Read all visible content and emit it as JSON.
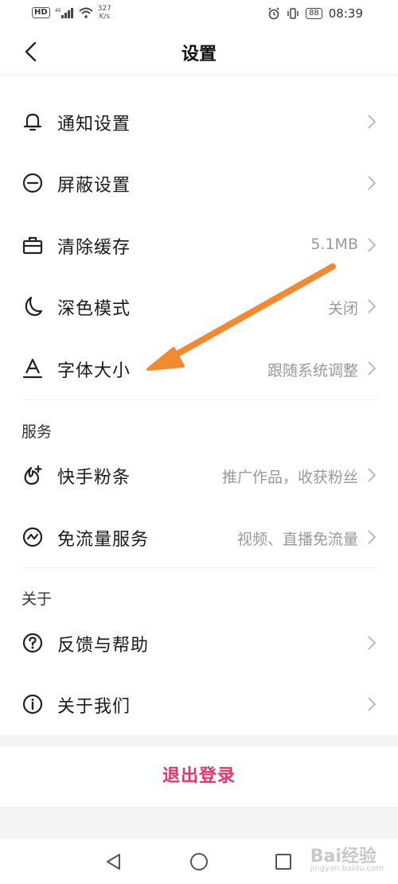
{
  "status_bar": {
    "hd": "HD",
    "net": "46",
    "speed_value": "327",
    "speed_unit": "K/s",
    "battery": "88",
    "time": "08:39"
  },
  "header": {
    "title": "设置"
  },
  "general": [
    {
      "label": "通知设置",
      "value": "",
      "icon": "bell-icon"
    },
    {
      "label": "屏蔽设置",
      "value": "",
      "icon": "block-icon"
    },
    {
      "label": "清除缓存",
      "value": "5.1MB",
      "icon": "toolbox-icon"
    },
    {
      "label": "深色模式",
      "value": "关闭",
      "icon": "moon-icon"
    },
    {
      "label": "字体大小",
      "value": "跟随系统调整",
      "icon": "font-icon"
    }
  ],
  "services": {
    "title": "服务",
    "items": [
      {
        "label": "快手粉条",
        "value": "推广作品，收获粉丝",
        "icon": "promote-icon"
      },
      {
        "label": "免流量服务",
        "value": "视频、直播免流量",
        "icon": "data-free-icon"
      }
    ]
  },
  "about": {
    "title": "关于",
    "items": [
      {
        "label": "反馈与帮助",
        "value": "",
        "icon": "help-icon"
      },
      {
        "label": "关于我们",
        "value": "",
        "icon": "info-icon"
      }
    ]
  },
  "logout_label": "退出登录",
  "watermark": {
    "brand": "Bai",
    "brand2": "经验",
    "sub": "jingyan.baidu.com"
  },
  "colors": {
    "accent": "#e43567",
    "annotation_arrow": "#f28a30",
    "secondary_text": "#999999"
  }
}
